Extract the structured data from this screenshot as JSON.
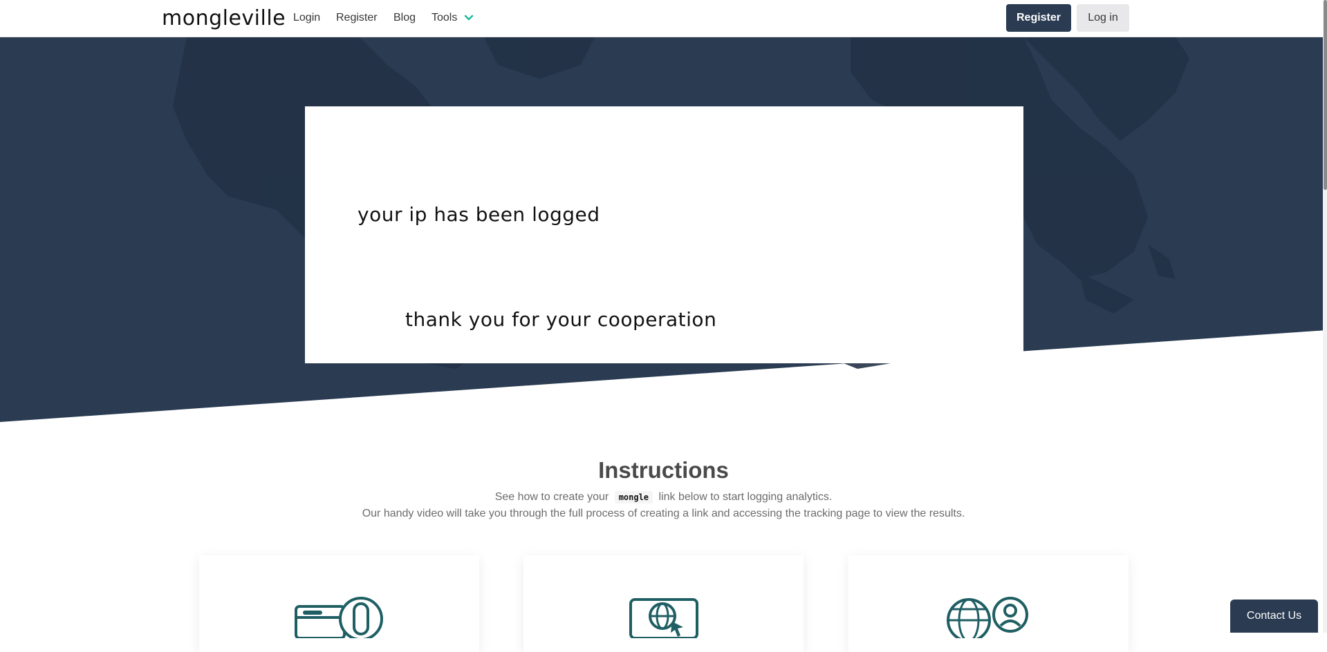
{
  "nav": {
    "brand": "mongleville",
    "links": [
      "Login",
      "Register",
      "Blog",
      "Tools"
    ],
    "register_button": "Register",
    "login_button": "Log in"
  },
  "hero": {
    "message_line1": "your ip has been logged",
    "message_line2": "thank you for your cooperation",
    "background_color": "#2a3b52"
  },
  "instructions": {
    "title": "Instructions",
    "line1_before": "See how to create your",
    "code": "mongle",
    "line1_after": "link below to start logging analytics.",
    "line2": "Our handy video will take you through the full process of creating a link and accessing the tracking page to view the results."
  },
  "feature_cards": [
    {
      "icon": "browser-touch-icon"
    },
    {
      "icon": "globe-cursor-icon"
    },
    {
      "icon": "globe-user-icon"
    }
  ],
  "contact": {
    "label": "Contact Us"
  },
  "colors": {
    "primary": "#2a3b52",
    "accent": "#1abc9c",
    "icon": "#1f5f63"
  }
}
